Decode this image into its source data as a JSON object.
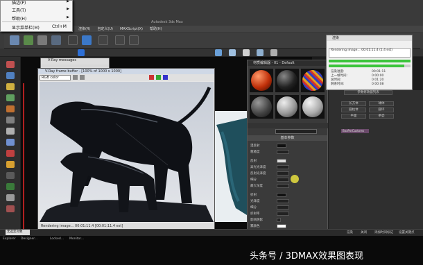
{
  "context_menu": {
    "items": [
      {
        "label": "描边(P)",
        "has_submenu": true
      },
      {
        "label": "工具(T)",
        "has_submenu": true
      },
      {
        "label": "帮助(H)",
        "has_submenu": true
      },
      {
        "label": "显示菜单栏(M)",
        "shortcut": "Ctrl+M"
      }
    ]
  },
  "app": {
    "title": "Autodesk 3ds Max",
    "menus": [
      "渲染(R)",
      "自定义(U)",
      "MAXScript(X)",
      "帮助(H)"
    ]
  },
  "vray_messages": {
    "title": "V-Ray messages"
  },
  "framebuffer": {
    "title": "V-Ray frame buffer - [100% of 1000 x 1000]",
    "channel": "RGB color",
    "status": "Rendering image... 00:01:11.4 [00:01:11.4 est]"
  },
  "material_editor": {
    "title": "材质编辑器 - 01 - Default",
    "rollout": "基本参数",
    "rows": [
      "漫反射",
      "粗糙度",
      "反射",
      "高光光泽度",
      "反射光泽度",
      "细分",
      "最大深度",
      "折射",
      "光泽度",
      "细分",
      "折射率",
      "影响阴影",
      "雾颜色"
    ]
  },
  "render_progress": {
    "title": "渲染",
    "list_text": "Rendering image... 00:01:11.4 (1.4 est)",
    "labels": [
      "渲染进度:",
      "上一帧时间:",
      "总时间:",
      "剩余时间:"
    ],
    "values": [
      "00:01:11",
      "0:00:00",
      "0:01:20",
      "0:00:08"
    ],
    "progress": [
      1.0,
      0.92
    ]
  },
  "command_panel": {
    "buttons": [
      "参数修改器列表",
      "长方体",
      "球体",
      "圆柱体",
      "圆环",
      "平面",
      "茶壶"
    ],
    "highlight": "BoxPorCustoms"
  },
  "status": {
    "selection": "无选定对象",
    "right_items": [
      "渲染",
      "关闭",
      "添加时间标记",
      "设置关键点"
    ]
  },
  "taskbar": {
    "items": [
      "Explorer",
      "Designer...",
      "Locked...",
      "Monitor..."
    ]
  },
  "watermark": "头条号 / 3DMAX效果图表现",
  "colors": {
    "progress_green": "#3cc43c",
    "accent_purple": "#6a4a6a",
    "watermark": "#ffffff"
  }
}
